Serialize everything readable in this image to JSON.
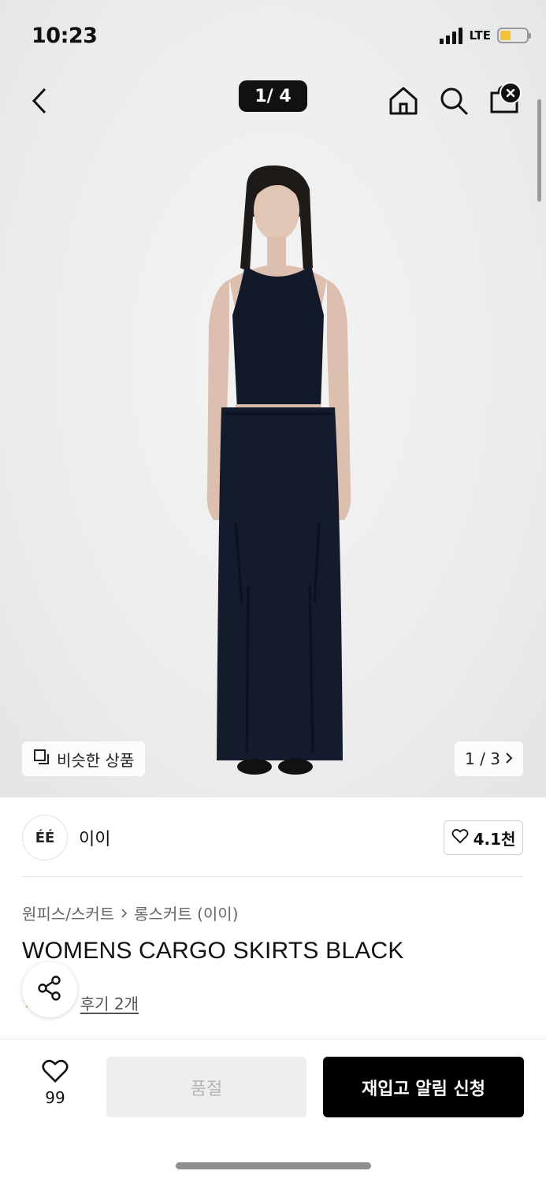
{
  "status_bar": {
    "time": "10:23",
    "network": "LTE",
    "battery_percent": 40
  },
  "nav": {
    "image_counter": "1/ 4"
  },
  "gallery": {
    "similar_label": "비슷한 상품",
    "page_indicator": "1 / 3"
  },
  "brand": {
    "logo_text": "ÉÉ",
    "name": "이이",
    "like_count": "4.1천"
  },
  "product": {
    "breadcrumb": [
      "원피스/스커트",
      "롱스커트 (이이)"
    ],
    "title": "WOMENS CARGO SKIRTS BLACK",
    "review_link": "후기 2개"
  },
  "bottom_bar": {
    "wish_count": "99",
    "soldout_label": "품절",
    "restock_label": "재입고 알림 신청"
  },
  "colors": {
    "primary": "#000000",
    "disabled_bg": "#eeeeee",
    "disabled_text": "#b5b5b5",
    "star": "#f0a63a"
  },
  "icons": [
    "back-icon",
    "home-icon",
    "search-icon",
    "cart-icon",
    "close-icon",
    "similar-icon",
    "chevron-right-icon",
    "heart-icon",
    "share-icon",
    "star-icon"
  ]
}
